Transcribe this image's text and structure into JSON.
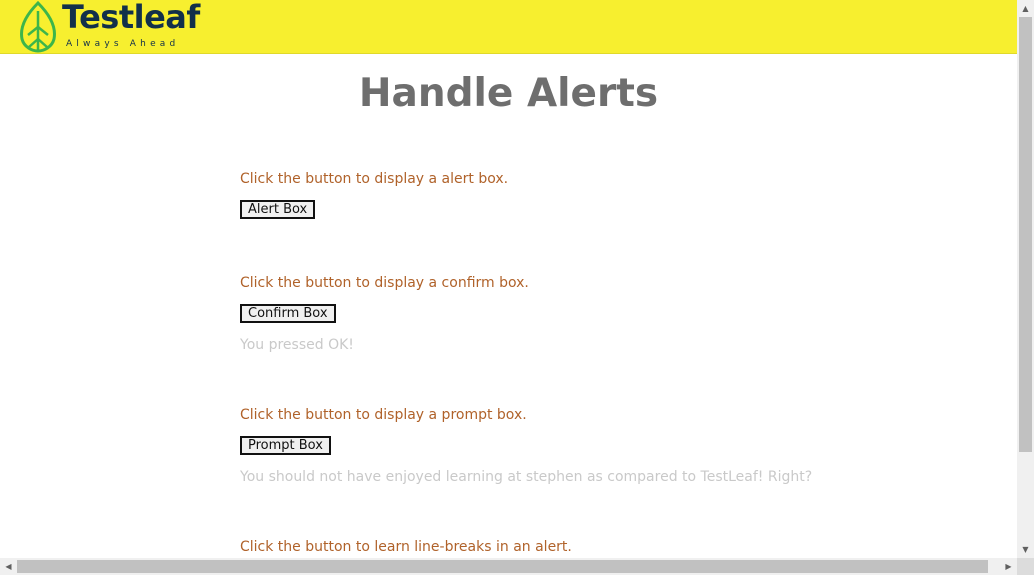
{
  "header": {
    "logo_name": "Testleaf",
    "logo_tagline": "Always Ahead",
    "brand_color": "#f7ef2f",
    "logo_icon": "leaf-icon"
  },
  "page": {
    "title": "Handle Alerts"
  },
  "sections": [
    {
      "description": "Click the button to display a alert box.",
      "button_label": "Alert Box",
      "result": ""
    },
    {
      "description": "Click the button to display a confirm box.",
      "button_label": "Confirm Box",
      "result": "You pressed OK!"
    },
    {
      "description": "Click the button to display a prompt box.",
      "button_label": "Prompt Box",
      "result": "You should not have enjoyed learning at stephen as compared to TestLeaf! Right?"
    },
    {
      "description": "Click the button to learn line-breaks in an alert.",
      "button_label": "",
      "result": ""
    }
  ],
  "scrollbars": {
    "up_arrow": "▲",
    "down_arrow": "▼",
    "left_arrow": "◀",
    "right_arrow": "▶"
  }
}
